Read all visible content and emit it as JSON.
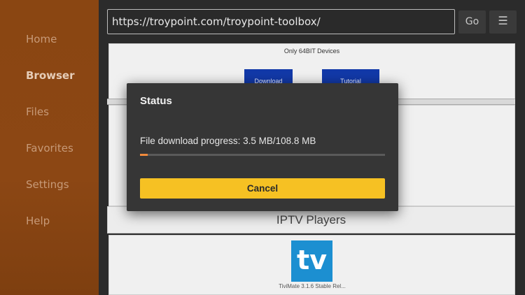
{
  "sidebar": {
    "items": [
      {
        "label": "Home",
        "active": false
      },
      {
        "label": "Browser",
        "active": true
      },
      {
        "label": "Files",
        "active": false
      },
      {
        "label": "Favorites",
        "active": false
      },
      {
        "label": "Settings",
        "active": false
      },
      {
        "label": "Help",
        "active": false
      }
    ]
  },
  "toolbar": {
    "url": "https://troypoint.com/troypoint-toolbox/",
    "go_label": "Go",
    "menu_icon": "hamburger-icon"
  },
  "webpage": {
    "note": "Only 64BIT Devices",
    "download_label": "Download",
    "tutorial_label": "Tutorial",
    "section_title": "IPTV Players",
    "app_logo_text": "tv",
    "app_caption": "TiviMate 3.1.6 Stable Rel..."
  },
  "dialog": {
    "title": "Status",
    "progress_text": "File download progress: 3.5 MB/108.8 MB",
    "progress_fraction": 0.032,
    "cancel_label": "Cancel"
  },
  "colors": {
    "sidebar": "#8a4612",
    "accent_button": "#f6c123",
    "progress": "#f08a3c",
    "dialog_bg": "#363636"
  }
}
